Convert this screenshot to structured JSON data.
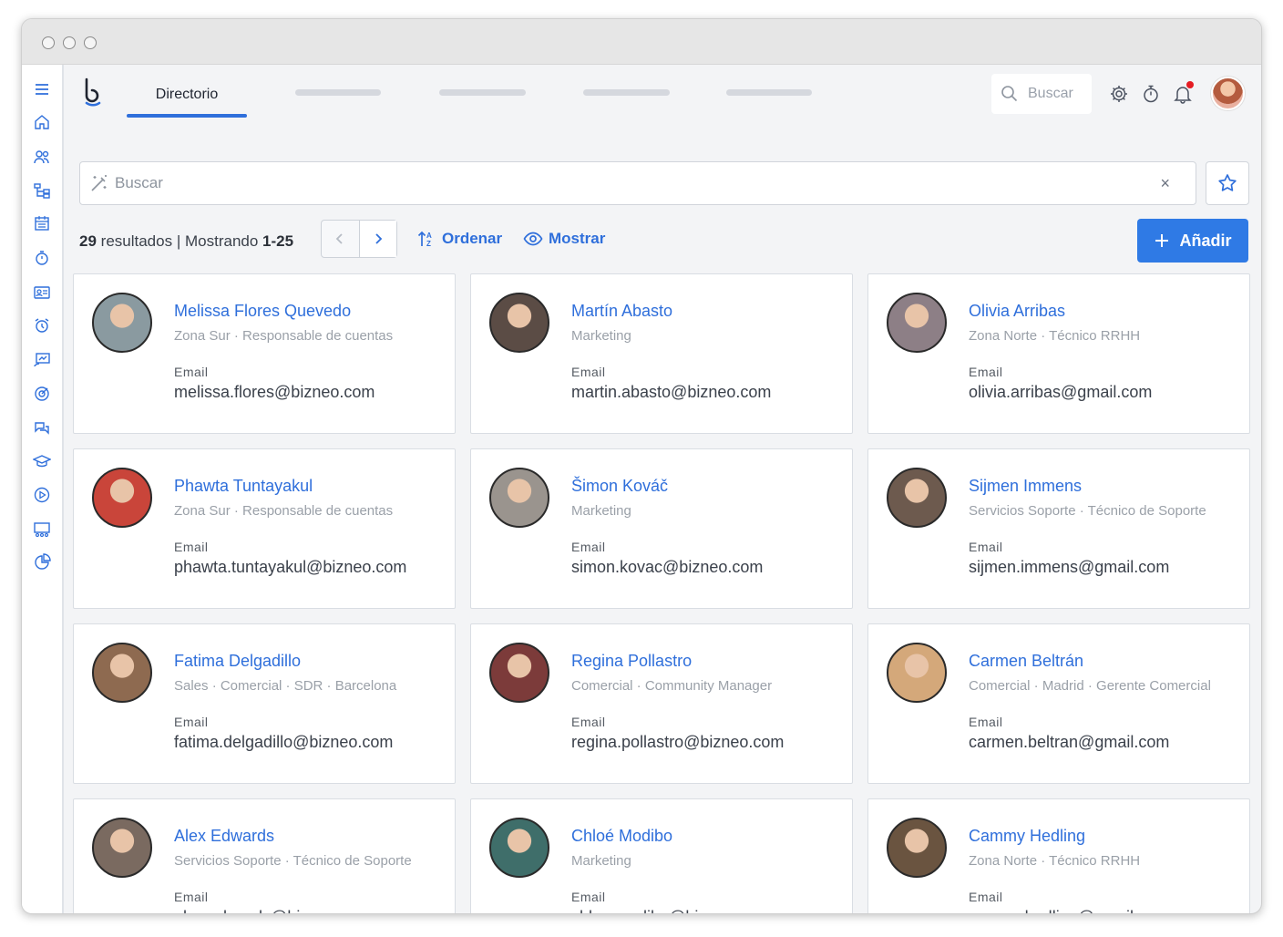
{
  "topnav": {
    "active_tab": "Directorio",
    "search_placeholder": "Buscar"
  },
  "search": {
    "placeholder": "Buscar",
    "clear": "×"
  },
  "toolbar": {
    "results_count": "29",
    "results_word": "resultados",
    "separator": "|",
    "showing_word": "Mostrando",
    "range": "1-25",
    "sort_label": "Ordenar",
    "show_label": "Mostrar",
    "add_label": "Añadir"
  },
  "colors": {
    "accent": "#2f6fdb",
    "button": "#2f7ae5",
    "notification": "#e51c23"
  },
  "sidebar_icons": [
    "menu-icon",
    "home-icon",
    "people-icon",
    "org-chart-icon",
    "calendar-icon",
    "timer-icon",
    "id-card-icon",
    "alarm-icon",
    "presentation-icon",
    "target-icon",
    "chat-icon",
    "graduation-icon",
    "play-icon",
    "classroom-icon",
    "pie-chart-icon"
  ],
  "employees": [
    {
      "name": "Melissa Flores Quevedo",
      "sub": "Zona Sur · Responsable de cuentas",
      "label": "Email",
      "email": "melissa.flores@bizneo.com",
      "tone": "#8a9aa0"
    },
    {
      "name": "Martín Abasto",
      "sub": "Marketing",
      "label": "Email",
      "email": "martin.abasto@bizneo.com",
      "tone": "#5b4c45"
    },
    {
      "name": "Olivia Arribas",
      "sub": "Zona Norte · Técnico RRHH",
      "label": "Email",
      "email": "olivia.arribas@gmail.com",
      "tone": "#8d7f86"
    },
    {
      "name": "Phawta Tuntayakul",
      "sub": "Zona Sur · Responsable de cuentas",
      "label": "Email",
      "email": "phawta.tuntayakul@bizneo.com",
      "tone": "#c9453a"
    },
    {
      "name": "Šimon Kováč",
      "sub": "Marketing",
      "label": "Email",
      "email": "simon.kovac@bizneo.com",
      "tone": "#9a948e"
    },
    {
      "name": "Sijmen Immens",
      "sub": "Servicios Soporte · Técnico de Soporte",
      "label": "Email",
      "email": "sijmen.immens@gmail.com",
      "tone": "#6d5a4e"
    },
    {
      "name": "Fatima Delgadillo",
      "sub": "Sales · Comercial · SDR · Barcelona",
      "label": "Email",
      "email": "fatima.delgadillo@bizneo.com",
      "tone": "#8e6a50"
    },
    {
      "name": "Regina Pollastro",
      "sub": "Comercial · Community Manager",
      "label": "Email",
      "email": "regina.pollastro@bizneo.com",
      "tone": "#7c3b3a"
    },
    {
      "name": "Carmen Beltrán",
      "sub": "Comercial · Madrid · Gerente Comercial",
      "label": "Email",
      "email": "carmen.beltran@gmail.com",
      "tone": "#d4a87a"
    },
    {
      "name": "Alex Edwards",
      "sub": "Servicios Soporte · Técnico de Soporte",
      "label": "Email",
      "email": "alex.edwards@bizneo.com",
      "tone": "#7a6a60"
    },
    {
      "name": "Chloé Modibo",
      "sub": "Marketing",
      "label": "Email",
      "email": "chloe.modibo@bizneo.com",
      "tone": "#3f6e6a"
    },
    {
      "name": "Cammy Hedling",
      "sub": "Zona Norte · Técnico RRHH",
      "label": "Email",
      "email": "cammy.hedling@gmail.com",
      "tone": "#6a5440"
    }
  ]
}
